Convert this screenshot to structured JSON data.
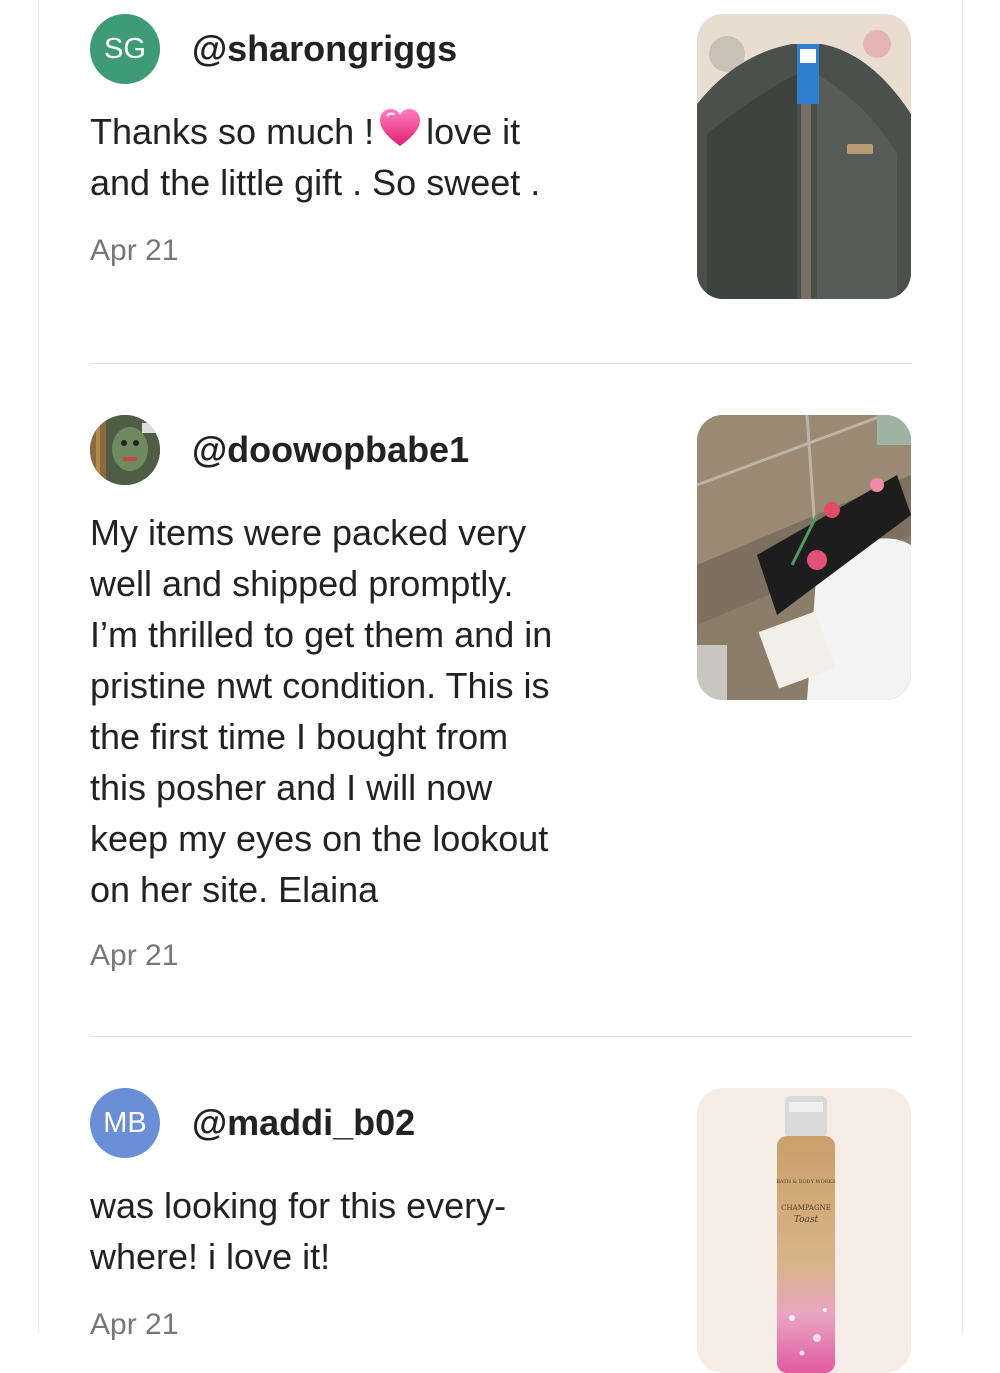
{
  "colors": {
    "avatar_sg": "#3f9a76",
    "avatar_mb": "#6a8fd6",
    "text": "#222222",
    "muted": "#777777",
    "divider": "#e2e2e2"
  },
  "reviews": [
    {
      "avatar_initials": "SG",
      "handle": "@sharongriggs",
      "text_before_emoji": "Thanks so much !",
      "emoji": "sparkling-heart-icon",
      "text_after_emoji": "love it\nand the little gift . So sweet .",
      "date": "Apr 21",
      "photo": "fleece-jacket-photo"
    },
    {
      "avatar_initials": "",
      "handle": "@doowopbabe1",
      "text": "My items were packed very\nwell and shipped promptly.\nI’m thrilled to get them and in\npristine nwt condition. This is\nthe first time I bought from\nthis posher and I will now\nkeep my eyes on the lookout\non her site. Elaina",
      "date": "Apr 21",
      "photo": "floral-cosmetic-bag-photo"
    },
    {
      "avatar_initials": "MB",
      "handle": "@maddi_b02",
      "text": "was looking for this every-\nwhere! i love it!",
      "date": "Apr 21",
      "photo": "champagne-toast-spray-photo",
      "photo_label": "CHAMPAGNE\nToast"
    }
  ]
}
